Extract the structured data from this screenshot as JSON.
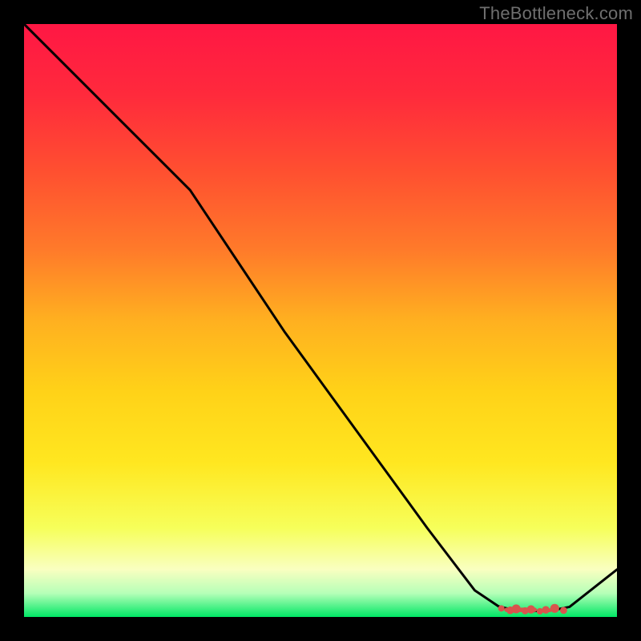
{
  "watermark": "TheBottleneck.com",
  "colors": {
    "background": "#000000",
    "curve_stroke": "#000000",
    "dot_fill": "#d9544d",
    "watermark": "#6f6f6f",
    "gradient_stops": [
      {
        "offset": 0.0,
        "color": "#ff1744"
      },
      {
        "offset": 0.12,
        "color": "#ff2a3c"
      },
      {
        "offset": 0.25,
        "color": "#ff5030"
      },
      {
        "offset": 0.38,
        "color": "#ff7a2a"
      },
      {
        "offset": 0.5,
        "color": "#ffb020"
      },
      {
        "offset": 0.62,
        "color": "#ffd218"
      },
      {
        "offset": 0.74,
        "color": "#ffe720"
      },
      {
        "offset": 0.85,
        "color": "#f6ff5a"
      },
      {
        "offset": 0.92,
        "color": "#f9ffc0"
      },
      {
        "offset": 0.96,
        "color": "#b6ffb8"
      },
      {
        "offset": 1.0,
        "color": "#00e765"
      }
    ]
  },
  "chart_data": {
    "type": "line",
    "title": "",
    "xlabel": "",
    "ylabel": "",
    "xlim": [
      0,
      100
    ],
    "ylim": [
      0,
      100
    ],
    "grid": false,
    "series": [
      {
        "name": "curve",
        "x": [
          0,
          8,
          16,
          24,
          28,
          36,
          44,
          52,
          60,
          68,
          76,
          80,
          82,
          84,
          86,
          88,
          90,
          92,
          100
        ],
        "y": [
          100,
          92,
          84,
          76,
          72,
          60,
          48,
          37,
          26,
          15,
          4.5,
          1.8,
          1.3,
          1.1,
          1.0,
          1.1,
          1.3,
          1.7,
          8
        ]
      }
    ],
    "optimal_zone": {
      "x_range": [
        80,
        92
      ],
      "y": 1.2,
      "dots_x": [
        80.5,
        82,
        83,
        84.5,
        85.5,
        87,
        88,
        89.5,
        91
      ]
    }
  }
}
